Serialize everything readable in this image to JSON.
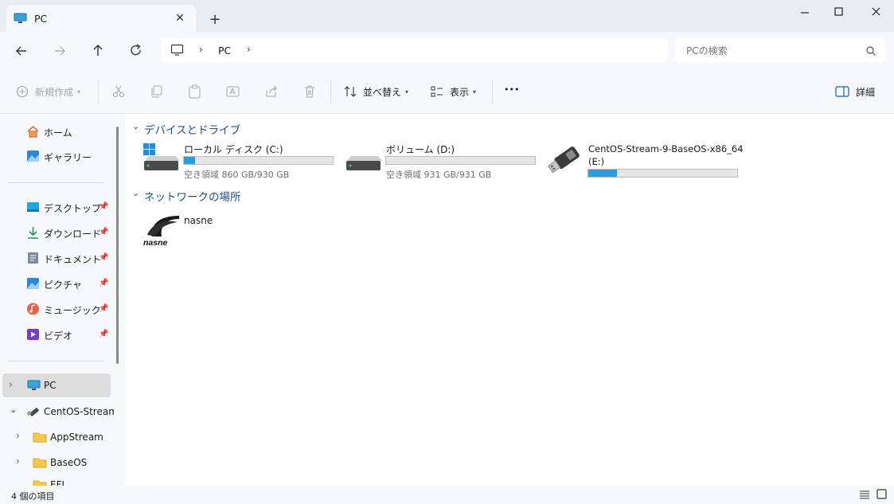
{
  "window": {
    "tab_title": "PC",
    "new_tab_label": "+"
  },
  "nav": {
    "breadcrumb": "PC",
    "search_placeholder": "PCの検索"
  },
  "toolbar": {
    "new_label": "新規作成",
    "sort_label": "並べ替え",
    "view_label": "表示",
    "more_label": "•••",
    "details_label": "詳細"
  },
  "sidebar": {
    "home": "ホーム",
    "gallery": "ギャラリー",
    "quick": [
      {
        "label": "デスクトップ",
        "icon": "desktop-icon"
      },
      {
        "label": "ダウンロード",
        "icon": "download-icon"
      },
      {
        "label": "ドキュメント",
        "icon": "document-icon"
      },
      {
        "label": "ピクチャ",
        "icon": "pictures-icon"
      },
      {
        "label": "ミュージック",
        "icon": "music-icon"
      },
      {
        "label": "ビデオ",
        "icon": "video-icon"
      }
    ],
    "pc": "PC",
    "usb": "CentOS-Stream-",
    "folders": [
      "AppStream",
      "BaseOS",
      "EFI"
    ]
  },
  "main": {
    "devices_header": "デバイスとドライブ",
    "network_header": "ネットワークの場所",
    "drives": [
      {
        "name": "ローカル ディスク (C:)",
        "free": "空き領域 860 GB/930 GB",
        "used_fraction": 0.075
      },
      {
        "name": "ボリューム (D:)",
        "free": "空き領域 931 GB/931 GB",
        "used_fraction": 0.0
      },
      {
        "name": "CentOS-Stream-9-BaseOS-x86_64",
        "name_line2": "(E:)",
        "used_fraction": 0.19
      }
    ],
    "network": [
      {
        "name": "nasne",
        "logo_text": "nasne"
      }
    ]
  },
  "status": {
    "item_count": "4 個の項目"
  },
  "colors": {
    "accent": "#26a0da",
    "folder": "#f7c948",
    "header_text": "#1e4e8c"
  }
}
